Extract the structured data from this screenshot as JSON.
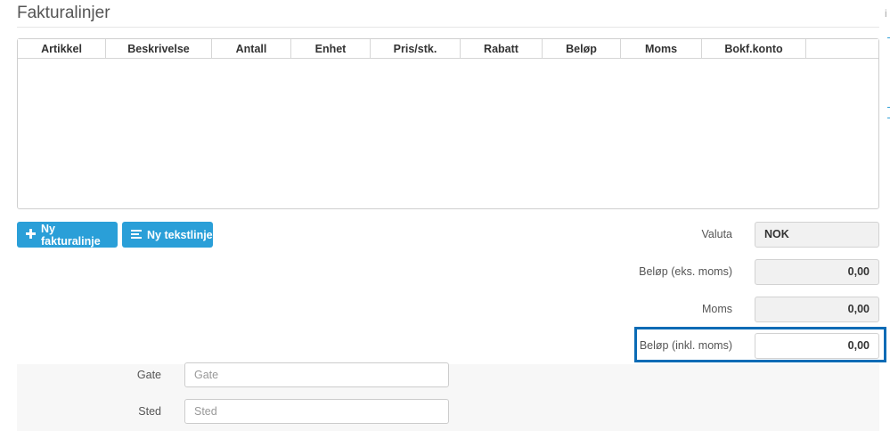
{
  "section": {
    "title": "Fakturalinjer"
  },
  "edge_marker": "i",
  "table": {
    "columns": [
      "Artikkel",
      "Beskrivelse",
      "Antall",
      "Enhet",
      "Pris/stk.",
      "Rabatt",
      "Beløp",
      "Moms",
      "Bokf.konto",
      ""
    ],
    "rows": []
  },
  "buttons": {
    "new_invoice_line": "Ny fakturalinje",
    "new_text_line": "Ny tekstlinje"
  },
  "summary": {
    "currency_label": "Valuta",
    "currency_value": "NOK",
    "amount_ex_vat_label": "Beløp (eks. moms)",
    "amount_ex_vat_value": "0,00",
    "vat_label": "Moms",
    "vat_value": "0,00",
    "amount_inc_vat_label": "Beløp (inkl. moms)",
    "amount_inc_vat_value": "0,00"
  },
  "address": {
    "street_label": "Gate",
    "street_placeholder": "Gate",
    "city_label": "Sted",
    "city_placeholder": "Sted"
  },
  "colors": {
    "accent": "#2a9fd8",
    "highlight": "#0b6bb5"
  },
  "icons": {
    "new_invoice_line": "plus-icon",
    "new_text_line": "text-lines-icon"
  }
}
